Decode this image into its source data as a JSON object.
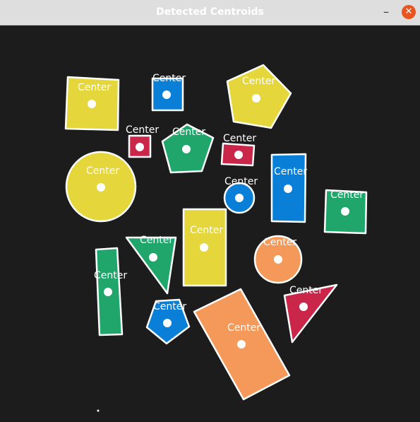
{
  "window": {
    "title": "Detected Centroids",
    "minimize_glyph": "–",
    "close_glyph": "✕"
  },
  "colors": {
    "background": "#1c1c1c",
    "outline": "#ffffff",
    "yellow": "#e4d63b",
    "blue": "#0a7fd8",
    "red": "#c9264a",
    "green": "#20a56a",
    "orange": "#f4995a"
  },
  "canvas": {
    "label": "Center"
  }
}
